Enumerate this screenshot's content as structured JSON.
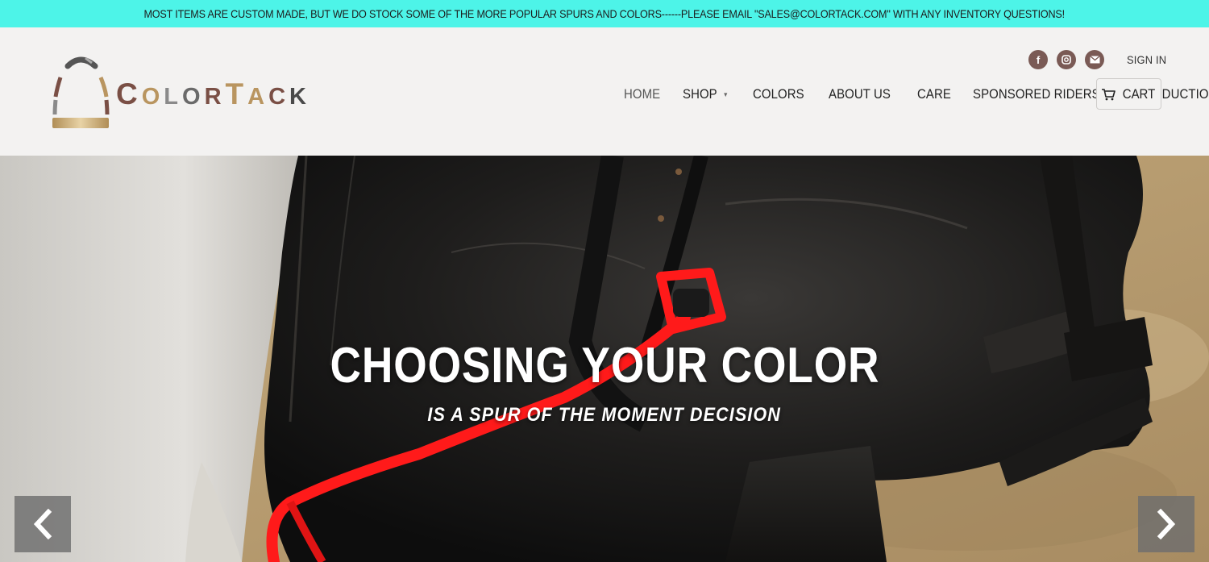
{
  "announcement": "MOST ITEMS ARE CUSTOM MADE, BUT WE DO STOCK SOME OF THE MORE POPULAR SPURS AND COLORS------PLEASE EMAIL \"SALES@COLORTACK.COM\" WITH ANY INVENTORY QUESTIONS!",
  "logo": {
    "letters": [
      {
        "char": "C",
        "color": "#7a4f45",
        "size": "big"
      },
      {
        "char": "O",
        "color": "#b99560",
        "size": "small"
      },
      {
        "char": "L",
        "color": "#8a8a8a",
        "size": "small"
      },
      {
        "char": "O",
        "color": "#6a6a6a",
        "size": "small"
      },
      {
        "char": "R",
        "color": "#7a4f45",
        "size": "small"
      },
      {
        "char": "T",
        "color": "#b99560",
        "size": "big"
      },
      {
        "char": "A",
        "color": "#b99560",
        "size": "small"
      },
      {
        "char": "C",
        "color": "#7a4f45",
        "size": "small"
      },
      {
        "char": "K",
        "color": "#4a4a4a",
        "size": "small"
      }
    ]
  },
  "social": {
    "facebook_icon": "f",
    "instagram_icon": "instagram-icon",
    "email_icon": "mail-icon"
  },
  "header": {
    "signin_label": "SIGN IN",
    "cart_label": "CART"
  },
  "nav": {
    "home": "HOME",
    "shop": "SHOP",
    "colors": "COLORS",
    "about": "ABOUT US",
    "care": "CARE",
    "riders": "SPONSORED RIDERS",
    "production": "PRODUCTION"
  },
  "hero": {
    "title": "CHOOSING YOUR COLOR",
    "subtitle": "IS A SPUR OF THE MOMENT DECISION"
  },
  "colors": {
    "announce_bg": "#4df4e8",
    "header_bg": "#f3f2f1",
    "social_bg": "#7a5a55",
    "spur_red": "#ff1a1a",
    "boot_black": "#1c1b1a"
  }
}
